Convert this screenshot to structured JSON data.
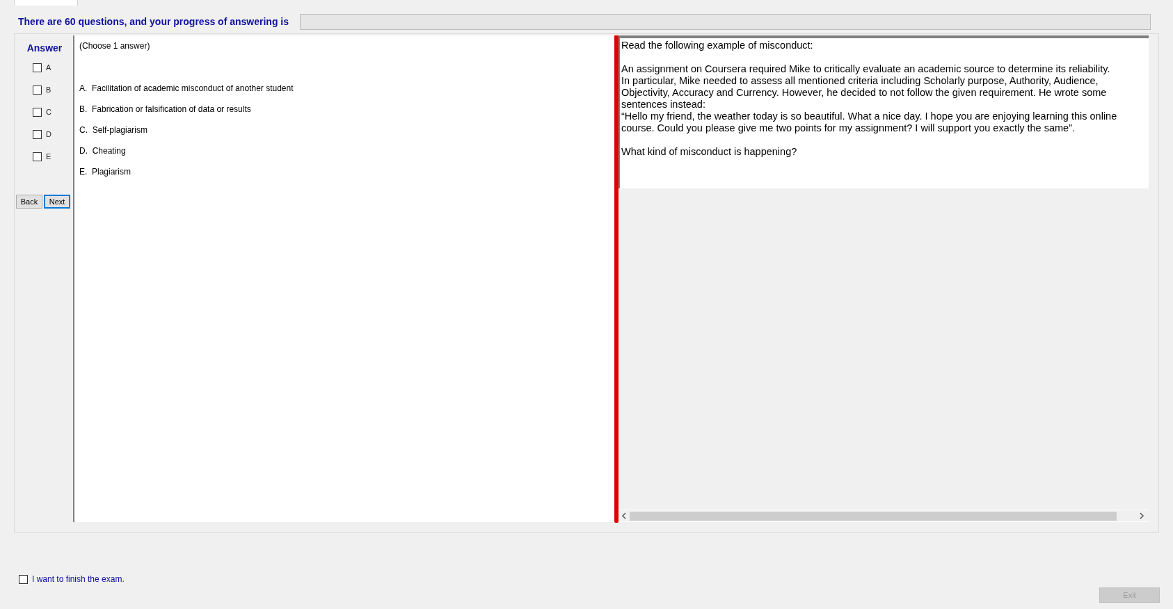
{
  "header": {
    "text": "There are 60 questions, and your progress of answering is",
    "progress": {
      "level": 0
    }
  },
  "answer_panel": {
    "title": "Answer",
    "options": [
      {
        "label": "A",
        "checked": false
      },
      {
        "label": "B",
        "checked": false
      },
      {
        "label": "C",
        "checked": false
      },
      {
        "label": "D",
        "checked": false
      },
      {
        "label": "E",
        "checked": false
      }
    ]
  },
  "nav_buttons": [
    {
      "label": "Back",
      "focused": false
    },
    {
      "label": "Next",
      "focused": true
    }
  ],
  "question": {
    "instruction": "(Choose 1 answer)",
    "choices": [
      {
        "letter": "A.",
        "text": "Facilitation of academic misconduct of another student"
      },
      {
        "letter": "B.",
        "text": "Fabrication or falsification of data or results"
      },
      {
        "letter": "C.",
        "text": "Self-plagiarism"
      },
      {
        "letter": "D.",
        "text": "Cheating"
      },
      {
        "letter": "E.",
        "text": "Plagiarism"
      }
    ]
  },
  "passage": {
    "blocks": [
      [
        "Read the following example of misconduct:"
      ],
      [
        "An assignment on Coursera required Mike to critically evaluate an academic source to determine its reliability.",
        "In particular, Mike needed to assess all mentioned criteria including Scholarly purpose, Authority, Audience, Objectivity, Accuracy and Currency. However, he decided to not follow the given requirement. He wrote some sentences instead:",
        "“Hello my friend, the weather today is so beautiful. What a nice day. I hope you are enjoying learning this online course. Could you please give me two points for my assignment? I will support you exactly the same”."
      ],
      [
        "What kind of misconduct is happening?"
      ]
    ]
  },
  "finish": {
    "label": "I want to finish the exam.",
    "checked": false
  },
  "exit_button": {
    "label": "Exit",
    "disabled": true
  }
}
